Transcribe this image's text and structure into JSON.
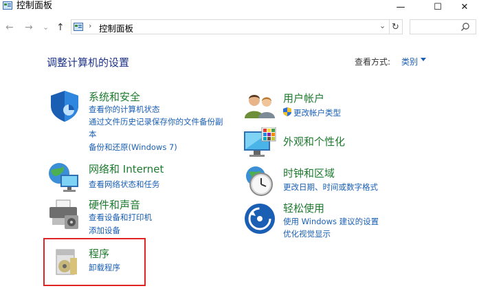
{
  "window": {
    "title": "控制面板",
    "minimize": "—",
    "maximize": "☐",
    "close": "✕"
  },
  "nav": {
    "back": "←",
    "forward": "→",
    "recent": "⌄",
    "up": "↑"
  },
  "address": {
    "separator": "›",
    "path": "控制面板",
    "dropdown": "⌄",
    "refresh": "↻"
  },
  "search": {
    "placeholder": "",
    "icon": "search-icon"
  },
  "main": {
    "title": "调整计算机的设置",
    "view_by_label": "查看方式:",
    "view_by_value": "类别"
  },
  "categories": [
    {
      "title": "系统和安全",
      "icon": "shield-icon",
      "links": [
        "查看你的计算机状态",
        "通过文件历史记录保存你的文件备份副",
        "本",
        "备份和还原(Windows 7)"
      ]
    },
    {
      "title": "网络和 Internet",
      "icon": "network-icon",
      "links": [
        "查看网络状态和任务"
      ]
    },
    {
      "title": "硬件和声音",
      "icon": "printer-icon",
      "links": [
        "查看设备和打印机",
        "添加设备"
      ]
    },
    {
      "title": "程序",
      "icon": "programs-icon",
      "links": [
        "卸载程序"
      ]
    },
    {
      "title": "用户帐户",
      "icon": "users-icon",
      "links": [
        "更改帐户类型"
      ]
    },
    {
      "title": "外观和个性化",
      "icon": "monitor-icon",
      "links": []
    },
    {
      "title": "时钟和区域",
      "icon": "clock-globe-icon",
      "links": [
        "更改日期、时间或数字格式"
      ]
    },
    {
      "title": "轻松使用",
      "icon": "ease-of-access-icon",
      "links": [
        "使用 Windows 建议的设置",
        "优化视觉显示"
      ]
    }
  ],
  "colors": {
    "category_title": "#1e7a2f",
    "link": "#1a5fb4",
    "page_title": "#1e3287",
    "highlight": "#e02424"
  }
}
